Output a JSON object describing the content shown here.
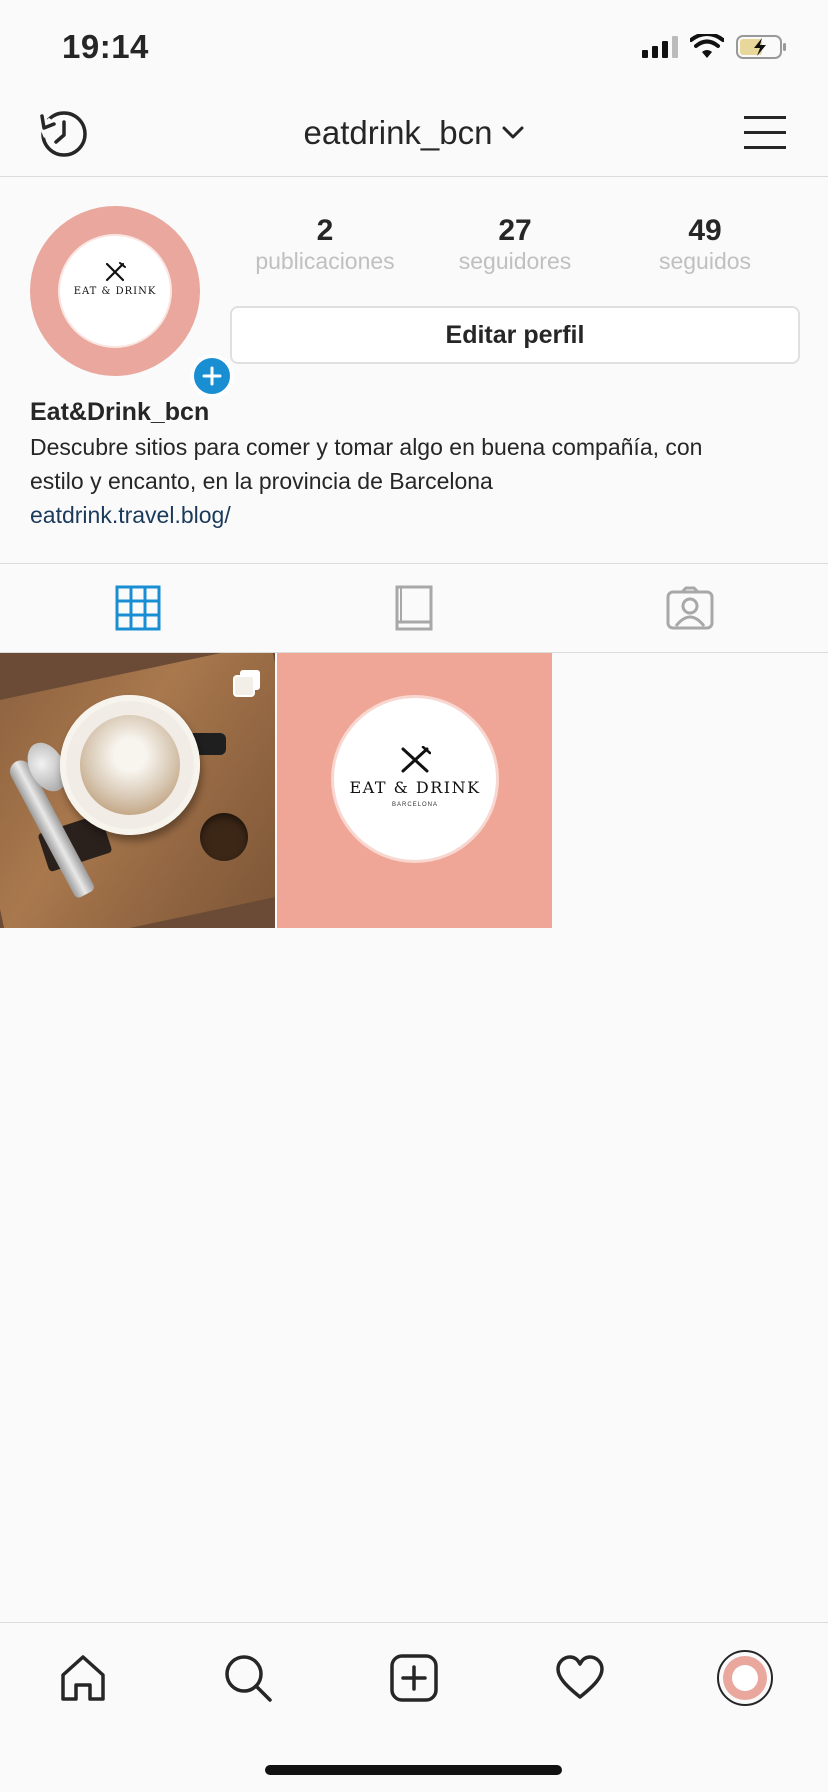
{
  "status_bar": {
    "time": "19:14"
  },
  "header": {
    "username": "eatdrink_bcn"
  },
  "profile": {
    "stats": [
      {
        "value": "2",
        "label": "publicaciones"
      },
      {
        "value": "27",
        "label": "seguidores"
      },
      {
        "value": "49",
        "label": "seguidos"
      }
    ],
    "edit_button_label": "Editar perfil",
    "display_name": "Eat&Drink_bcn",
    "bio_line1": "Descubre sitios para comer y tomar algo en buena compañía, con",
    "bio_line2": "estilo y encanto, en la provincia de Barcelona",
    "link": "eatdrink.travel.blog/",
    "avatar_logo_text": "EAT & DRINK"
  },
  "posts": [
    {
      "kind": "photo",
      "icon": "multiple-photos-icon"
    },
    {
      "kind": "logo",
      "logo_text": "EAT & DRINK",
      "logo_sub": "BARCELONA"
    }
  ],
  "colors": {
    "accent_blue": "#1a8ed2",
    "brand_pink": "#f0a697",
    "link_color": "#1b3a5b"
  }
}
